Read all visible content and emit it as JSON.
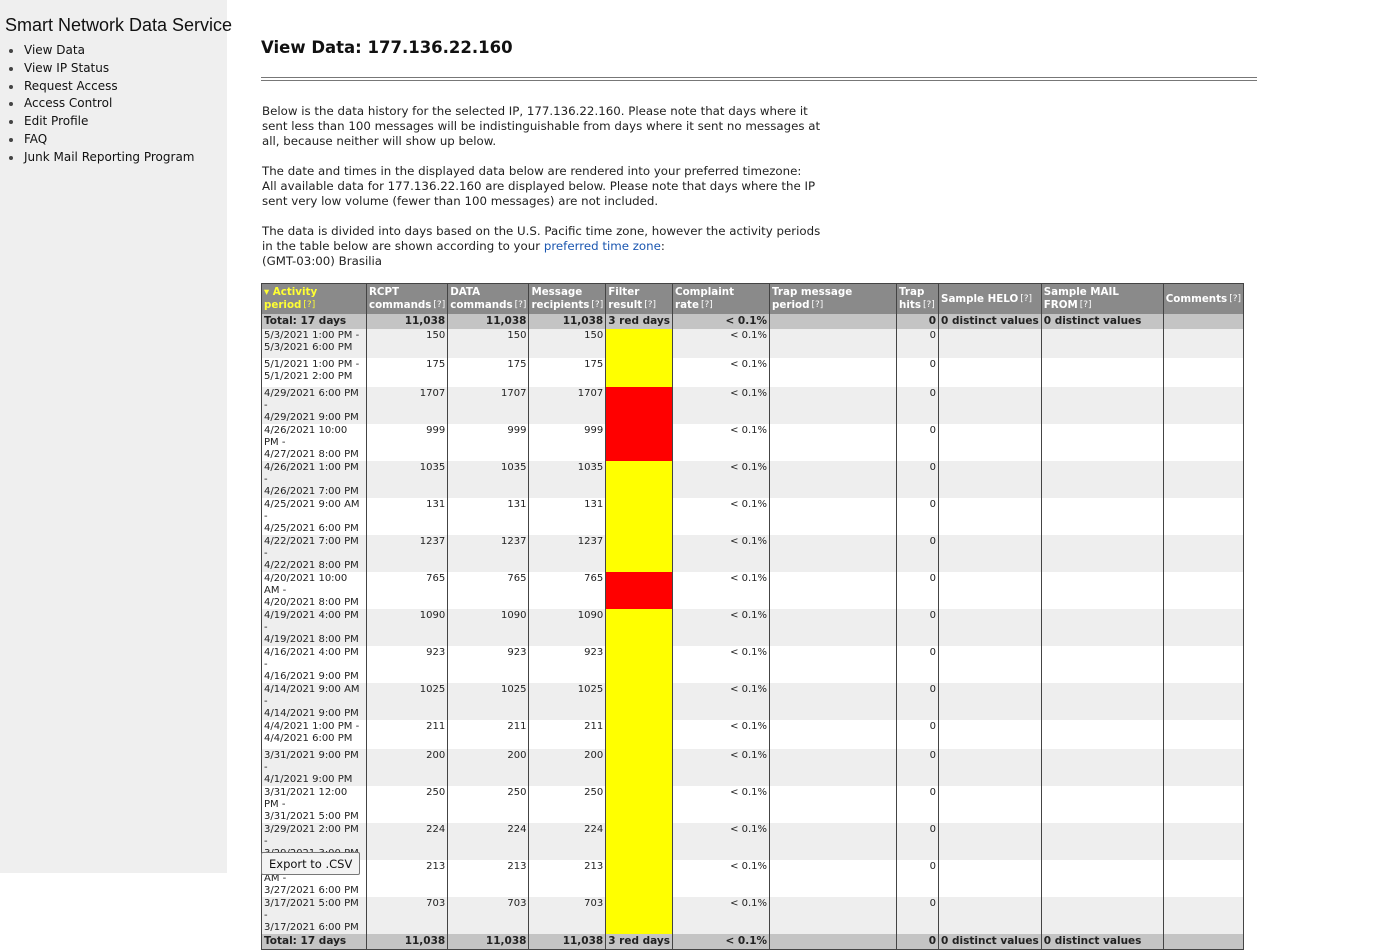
{
  "sidebar": {
    "brand": "Smart Network Data Service",
    "items": [
      {
        "label": "View Data"
      },
      {
        "label": "View IP Status"
      },
      {
        "label": "Request Access"
      },
      {
        "label": "Access Control"
      },
      {
        "label": "Edit Profile"
      },
      {
        "label": "FAQ"
      },
      {
        "label": "Junk Mail Reporting Program"
      }
    ]
  },
  "main": {
    "title": "View Data: 177.136.22.160",
    "intro": {
      "p1": "Below is the data history for the selected IP, 177.136.22.160.  Please note that days where it sent less than 100 messages will be indistinguishable from days where it sent no messages at all, because neither will show up below.",
      "p2_line1": "The date and times in the displayed data below are rendered into your preferred timezone:",
      "p2_line2": "All available data for 177.136.22.160 are displayed below. Please note that days where the IP sent very low volume (fewer than 100 messages) are not included.",
      "p3_before": "The data is divided into days based on the U.S. Pacific time zone, however the activity periods in the table below are shown according to your ",
      "p3_link": "preferred time zone",
      "p3_after": ":",
      "timezone": "(GMT-03:00) Brasilia"
    },
    "export_label": "Export to .CSV"
  },
  "table": {
    "help_marker": "[?]",
    "sort_marker": "▾",
    "headers": {
      "activity_period": "Activity period",
      "rcpt": "RCPT commands",
      "data": "DATA commands",
      "recipients": "Message recipients",
      "filter": "Filter result",
      "complaint": "Complaint rate",
      "trap_period": "Trap message period",
      "trap_hits": "Trap hits",
      "helo": "Sample HELO",
      "mailfrom": "Sample MAIL FROM",
      "comments": "Comments"
    },
    "total": {
      "label": "Total: 17 days",
      "rcpt": "11,038",
      "data": "11,038",
      "recipients": "11,038",
      "filter": "3 red days",
      "complaint": "< 0.1%",
      "trap_hits": "0",
      "helo": "0 distinct values",
      "mailfrom": "0 distinct values"
    },
    "rows": [
      {
        "start": "5/3/2021 1:00 PM -",
        "end": "5/3/2021 6:00 PM",
        "rcpt": "150",
        "data": "150",
        "recipients": "150",
        "filter": "yellow",
        "complaint": "< 0.1%",
        "trap_hits": "0"
      },
      {
        "start": "5/1/2021 1:00 PM -",
        "end": "5/1/2021 2:00 PM",
        "rcpt": "175",
        "data": "175",
        "recipients": "175",
        "filter": "yellow",
        "complaint": "< 0.1%",
        "trap_hits": "0"
      },
      {
        "start": "4/29/2021 6:00 PM -",
        "end": "4/29/2021 9:00 PM",
        "rcpt": "1707",
        "data": "1707",
        "recipients": "1707",
        "filter": "red",
        "complaint": "< 0.1%",
        "trap_hits": "0"
      },
      {
        "start": "4/26/2021 10:00 PM -",
        "end": "4/27/2021 8:00 PM",
        "rcpt": "999",
        "data": "999",
        "recipients": "999",
        "filter": "red",
        "complaint": "< 0.1%",
        "trap_hits": "0"
      },
      {
        "start": "4/26/2021 1:00 PM -",
        "end": "4/26/2021 7:00 PM",
        "rcpt": "1035",
        "data": "1035",
        "recipients": "1035",
        "filter": "yellow",
        "complaint": "< 0.1%",
        "trap_hits": "0"
      },
      {
        "start": "4/25/2021 9:00 AM -",
        "end": "4/25/2021 6:00 PM",
        "rcpt": "131",
        "data": "131",
        "recipients": "131",
        "filter": "yellow",
        "complaint": "< 0.1%",
        "trap_hits": "0"
      },
      {
        "start": "4/22/2021 7:00 PM -",
        "end": "4/22/2021 8:00 PM",
        "rcpt": "1237",
        "data": "1237",
        "recipients": "1237",
        "filter": "yellow",
        "complaint": "< 0.1%",
        "trap_hits": "0"
      },
      {
        "start": "4/20/2021 10:00 AM -",
        "end": "4/20/2021 8:00 PM",
        "rcpt": "765",
        "data": "765",
        "recipients": "765",
        "filter": "red",
        "complaint": "< 0.1%",
        "trap_hits": "0"
      },
      {
        "start": "4/19/2021 4:00 PM -",
        "end": "4/19/2021 8:00 PM",
        "rcpt": "1090",
        "data": "1090",
        "recipients": "1090",
        "filter": "yellow",
        "complaint": "< 0.1%",
        "trap_hits": "0"
      },
      {
        "start": "4/16/2021 4:00 PM -",
        "end": "4/16/2021 9:00 PM",
        "rcpt": "923",
        "data": "923",
        "recipients": "923",
        "filter": "yellow",
        "complaint": "< 0.1%",
        "trap_hits": "0"
      },
      {
        "start": "4/14/2021 9:00 AM -",
        "end": "4/14/2021 9:00 PM",
        "rcpt": "1025",
        "data": "1025",
        "recipients": "1025",
        "filter": "yellow",
        "complaint": "< 0.1%",
        "trap_hits": "0"
      },
      {
        "start": "4/4/2021 1:00 PM -",
        "end": "4/4/2021 6:00 PM",
        "rcpt": "211",
        "data": "211",
        "recipients": "211",
        "filter": "yellow",
        "complaint": "< 0.1%",
        "trap_hits": "0"
      },
      {
        "start": "3/31/2021 9:00 PM -",
        "end": "4/1/2021 9:00 PM",
        "rcpt": "200",
        "data": "200",
        "recipients": "200",
        "filter": "yellow",
        "complaint": "< 0.1%",
        "trap_hits": "0"
      },
      {
        "start": "3/31/2021 12:00 PM -",
        "end": "3/31/2021 5:00 PM",
        "rcpt": "250",
        "data": "250",
        "recipients": "250",
        "filter": "yellow",
        "complaint": "< 0.1%",
        "trap_hits": "0"
      },
      {
        "start": "3/29/2021 2:00 PM -",
        "end": "3/29/2021 3:00 PM",
        "rcpt": "224",
        "data": "224",
        "recipients": "224",
        "filter": "yellow",
        "complaint": "< 0.1%",
        "trap_hits": "0"
      },
      {
        "start": "3/27/2021 10:00 AM -",
        "end": "3/27/2021 6:00 PM",
        "rcpt": "213",
        "data": "213",
        "recipients": "213",
        "filter": "yellow",
        "complaint": "< 0.1%",
        "trap_hits": "0"
      },
      {
        "start": "3/17/2021 5:00 PM -",
        "end": "3/17/2021 6:00 PM",
        "rcpt": "703",
        "data": "703",
        "recipients": "703",
        "filter": "yellow",
        "complaint": "< 0.1%",
        "trap_hits": "0"
      }
    ]
  }
}
